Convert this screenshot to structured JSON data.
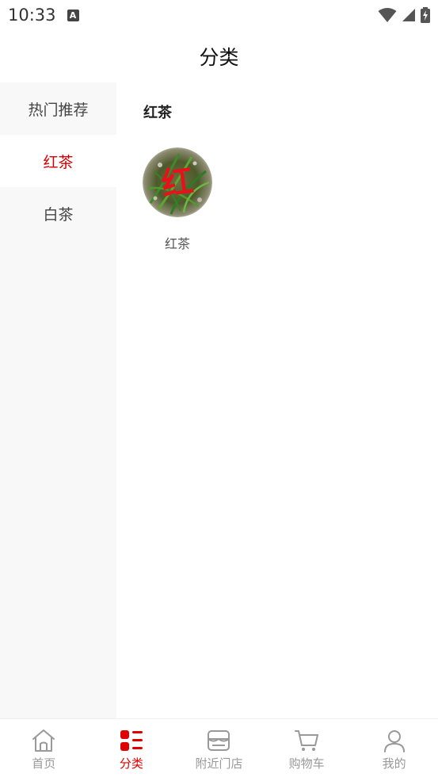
{
  "status_bar": {
    "time": "10:33",
    "notification_letter": "A"
  },
  "header": {
    "title": "分类"
  },
  "sidebar": {
    "items": [
      {
        "label": "热门推荐",
        "active": false
      },
      {
        "label": "红茶",
        "active": true
      },
      {
        "label": "白茶",
        "active": false
      }
    ]
  },
  "content": {
    "section_title": "红茶",
    "items": [
      {
        "label": "红茶",
        "thumb_text": "红"
      }
    ]
  },
  "tabbar": {
    "items": [
      {
        "label": "首页",
        "icon": "home-icon",
        "active": false
      },
      {
        "label": "分类",
        "icon": "category-icon",
        "active": true
      },
      {
        "label": "附近门店",
        "icon": "store-icon",
        "active": false
      },
      {
        "label": "购物车",
        "icon": "cart-icon",
        "active": false
      },
      {
        "label": "我的",
        "icon": "user-icon",
        "active": false
      }
    ]
  },
  "colors": {
    "accent": "#e00000",
    "sidebar_bg": "#f8f8f8",
    "inactive": "#999999"
  }
}
